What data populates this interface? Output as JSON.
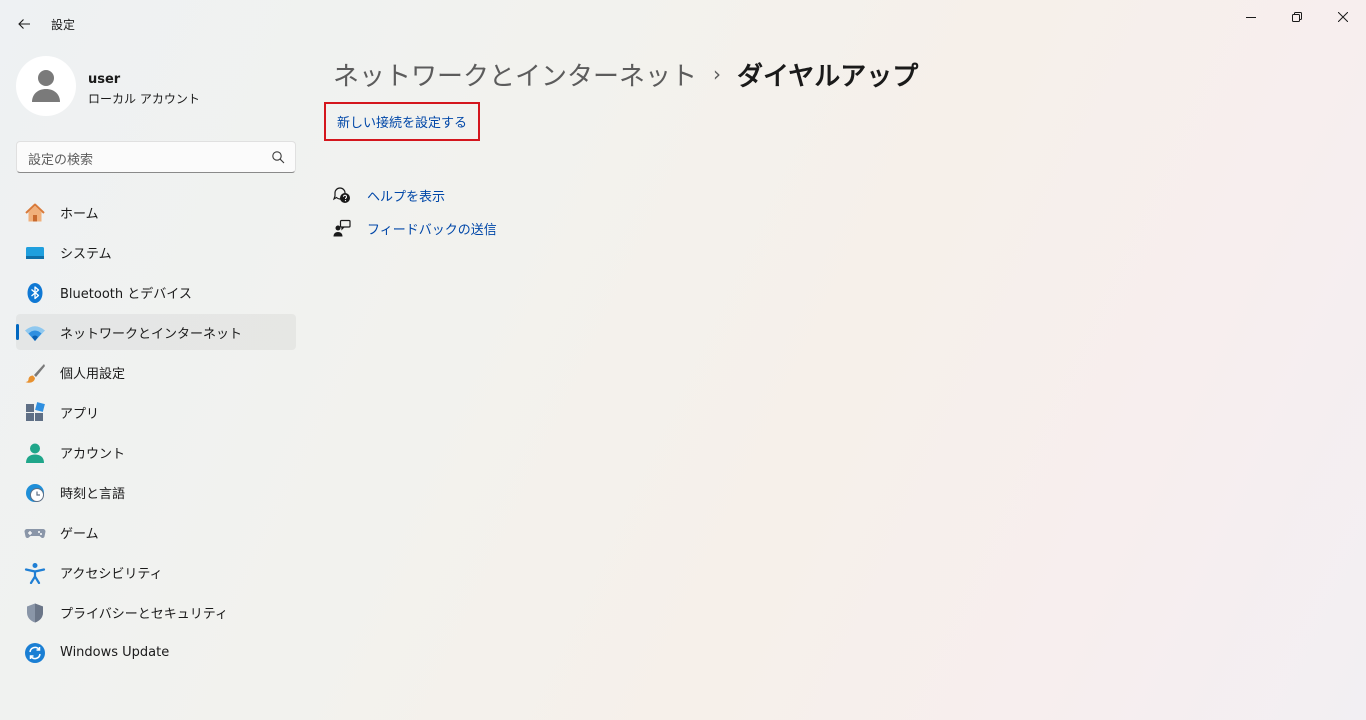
{
  "window": {
    "title": "設定"
  },
  "profile": {
    "name": "user",
    "account_type": "ローカル アカウント"
  },
  "search": {
    "placeholder": "設定の検索"
  },
  "sidebar": {
    "items": [
      {
        "label": "ホーム",
        "icon": "home-icon"
      },
      {
        "label": "システム",
        "icon": "system-icon"
      },
      {
        "label": "Bluetooth とデバイス",
        "icon": "bluetooth-icon"
      },
      {
        "label": "ネットワークとインターネット",
        "icon": "wifi-icon",
        "selected": true
      },
      {
        "label": "個人用設定",
        "icon": "brush-icon"
      },
      {
        "label": "アプリ",
        "icon": "apps-icon"
      },
      {
        "label": "アカウント",
        "icon": "account-icon"
      },
      {
        "label": "時刻と言語",
        "icon": "time-language-icon"
      },
      {
        "label": "ゲーム",
        "icon": "gamepad-icon"
      },
      {
        "label": "アクセシビリティ",
        "icon": "accessibility-icon"
      },
      {
        "label": "プライバシーとセキュリティ",
        "icon": "shield-icon"
      },
      {
        "label": "Windows Update",
        "icon": "windows-update-icon"
      }
    ]
  },
  "main": {
    "breadcrumb_parent": "ネットワークとインターネット",
    "breadcrumb_separator": "›",
    "breadcrumb_current": "ダイヤルアップ",
    "new_connection_label": "新しい接続を設定する",
    "help_label": "ヘルプを表示",
    "feedback_label": "フィードバックの送信"
  },
  "colors": {
    "accent": "#0067c0",
    "link": "#0047a8",
    "highlight_border": "#d4161d"
  }
}
